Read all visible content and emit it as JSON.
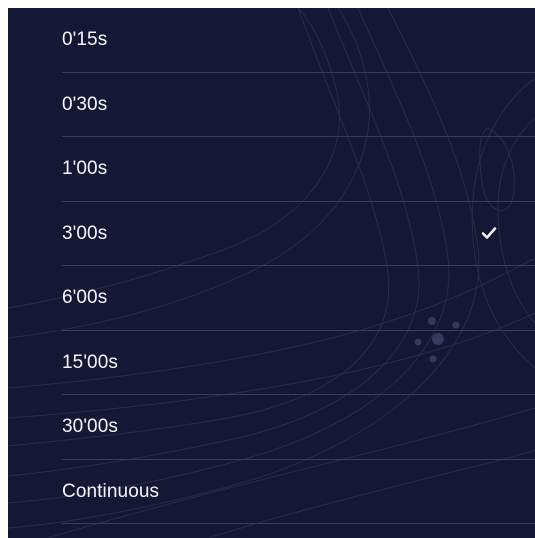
{
  "interval_list": {
    "options": [
      {
        "label": "0'15s",
        "selected": false
      },
      {
        "label": "0'30s",
        "selected": false
      },
      {
        "label": "1'00s",
        "selected": false
      },
      {
        "label": "3'00s",
        "selected": true
      },
      {
        "label": "6'00s",
        "selected": false
      },
      {
        "label": "15'00s",
        "selected": false
      },
      {
        "label": "30'00s",
        "selected": false
      },
      {
        "label": "Continuous",
        "selected": false
      }
    ],
    "selected_icon": "checkmark-icon"
  },
  "theme": {
    "background": "#151834",
    "text": "#f4f5fb",
    "divider": "#3a3e5e",
    "contour": "#8a90c0"
  }
}
